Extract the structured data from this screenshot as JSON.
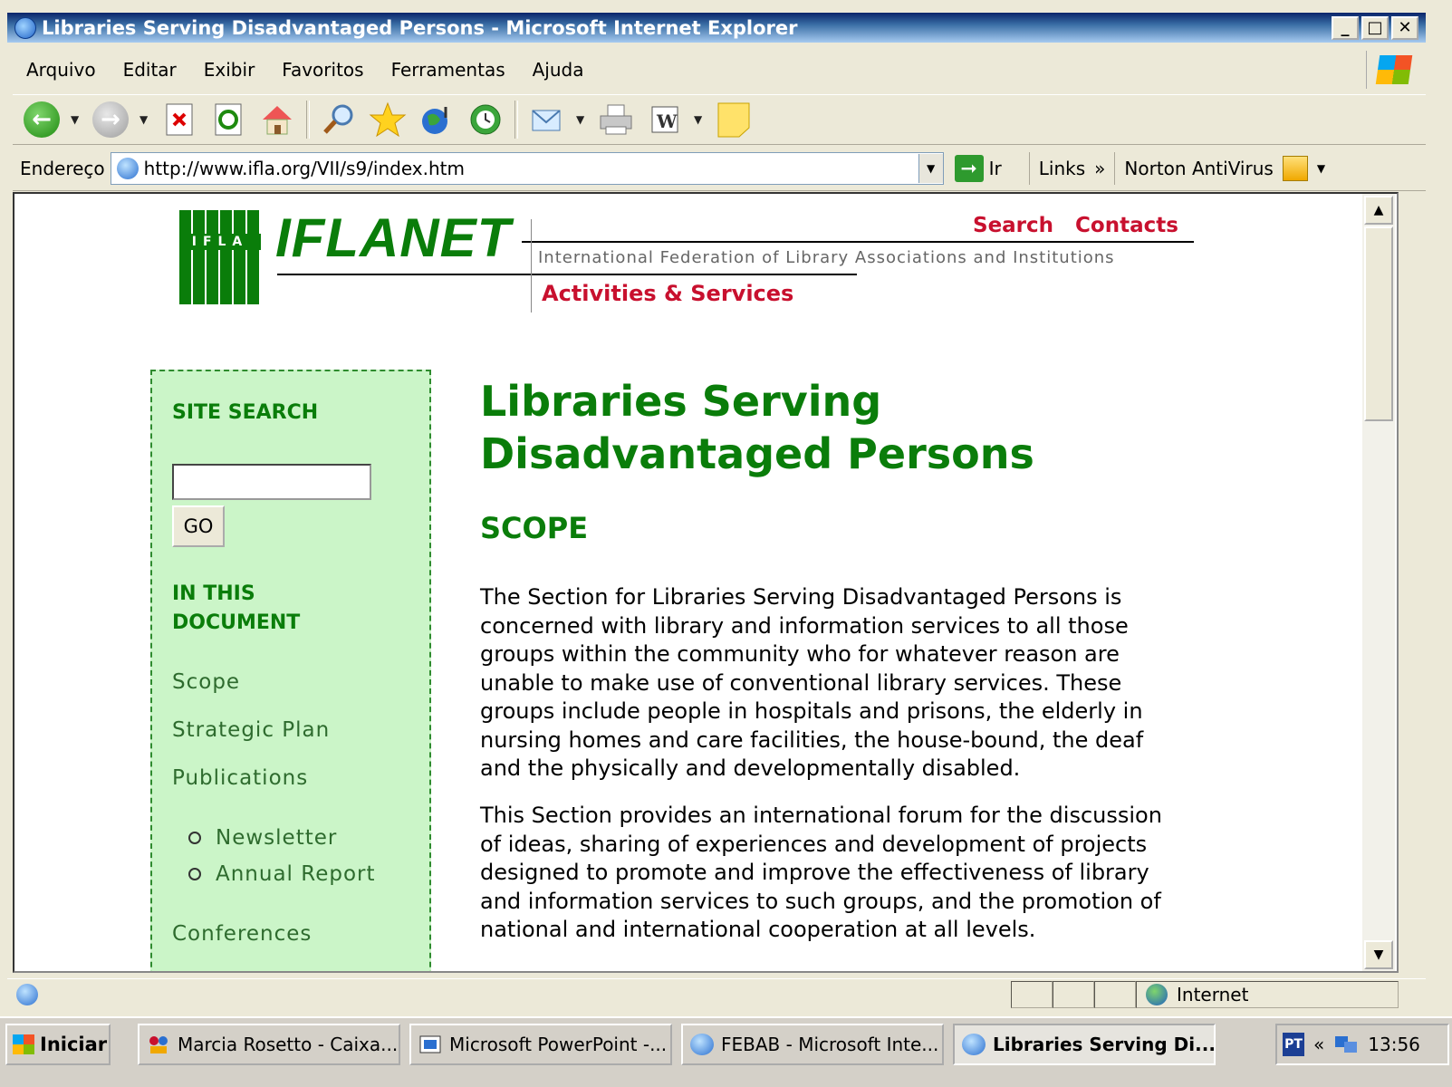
{
  "window": {
    "title": "Libraries Serving Disadvantaged Persons - Microsoft Internet Explorer",
    "controls": [
      "_",
      "□",
      "✕"
    ]
  },
  "menu": [
    "Arquivo",
    "Editar",
    "Exibir",
    "Favoritos",
    "Ferramentas",
    "Ajuda"
  ],
  "toolbar": {
    "icons": [
      "back-icon",
      "forward-icon",
      "stop-icon",
      "refresh-icon",
      "home-icon",
      "search-icon",
      "favorites-icon",
      "media-icon",
      "history-icon",
      "mail-icon",
      "print-icon",
      "word-icon",
      "notes-icon"
    ]
  },
  "address": {
    "label": "Endereço",
    "url": "http://www.ifla.org/VII/s9/index.htm",
    "go_label": "Ir",
    "links_label": "Links",
    "chevron": "»",
    "norton_label": "Norton AntiVirus"
  },
  "page": {
    "header": {
      "logo_text": "IFLA",
      "brand": "IFLANET",
      "search_link": "Search",
      "contacts_link": "Contacts",
      "federation": "International Federation of Library Associations and Institutions",
      "activities": "Activities & Services"
    },
    "sidebar": {
      "site_search_heading": "SITE SEARCH",
      "search_value": "",
      "go_label": "GO",
      "in_doc_heading_1": "IN THIS",
      "in_doc_heading_2": "DOCUMENT",
      "links": [
        "Scope",
        "Strategic Plan",
        "Publications"
      ],
      "sublinks": [
        "Newsletter",
        "Annual Report"
      ],
      "conferences": "Conferences"
    },
    "main": {
      "title_line1": "Libraries Serving",
      "title_line2": "Disadvantaged Persons",
      "section_heading": "SCOPE",
      "para1_lines": [
        "The Section for Libraries Serving Disadvantaged Persons is",
        "concerned with library and information services to all those",
        "groups within the community who for whatever reason are",
        "unable to make use of conventional library services. These",
        "groups include people in hospitals and prisons, the elderly in",
        "nursing homes and care facilities, the house-bound, the deaf",
        "and the physically and developmentally disabled."
      ],
      "para2_lines": [
        "This Section provides an international forum for the discussion",
        "of ideas, sharing of experiences and development of projects",
        "designed to promote and improve the effectiveness of library",
        "and information services to such groups, and the promotion of",
        "national and international cooperation at all levels."
      ]
    }
  },
  "status": {
    "zone_label": "Internet"
  },
  "taskbar": {
    "start_label": "Iniciar",
    "buttons": [
      "Marcia Rosetto - Caixa...",
      "Microsoft PowerPoint -...",
      "FEBAB - Microsoft Inte...",
      "Libraries Serving Di..."
    ],
    "lang": "PT",
    "chevron": "«",
    "clock": "13:56"
  }
}
